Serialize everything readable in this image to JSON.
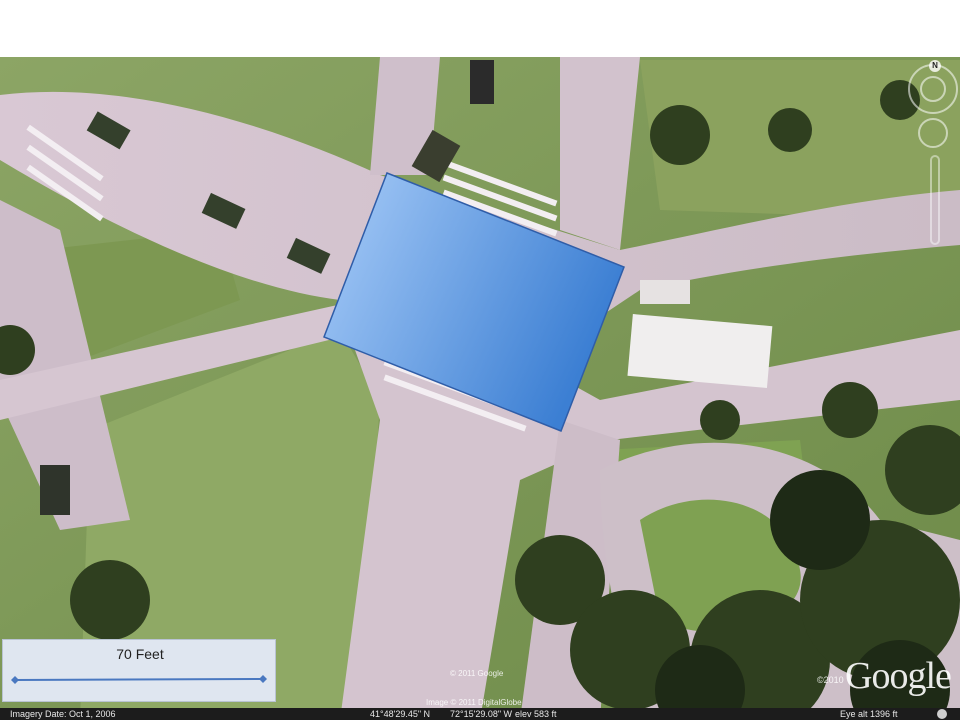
{
  "map": {
    "type": "satellite aerial imagery",
    "overlay_shape": {
      "fill": "blue gradient",
      "stroke": "#2f5da8",
      "color_light": "#9ec4f7",
      "color_dark": "#3a7fd5"
    }
  },
  "scale_bar": {
    "label": "70 Feet",
    "color": "#4a78c0"
  },
  "attribution": {
    "google_copyright": "© 2011 Google",
    "imagery_copyright": "Image © 2011 DigitalGlobe",
    "logo_year": "©2010",
    "logo_text": "Google"
  },
  "status_bar": {
    "imagery_date": "Imagery Date: Oct  1, 2006",
    "latitude": "41°48'29.45\" N",
    "longitude": "72°15'29.08\" W",
    "elevation": "elev   583 ft",
    "eye_alt": "Eye alt    1396 ft"
  },
  "navigation": {
    "compass_label": "N"
  }
}
